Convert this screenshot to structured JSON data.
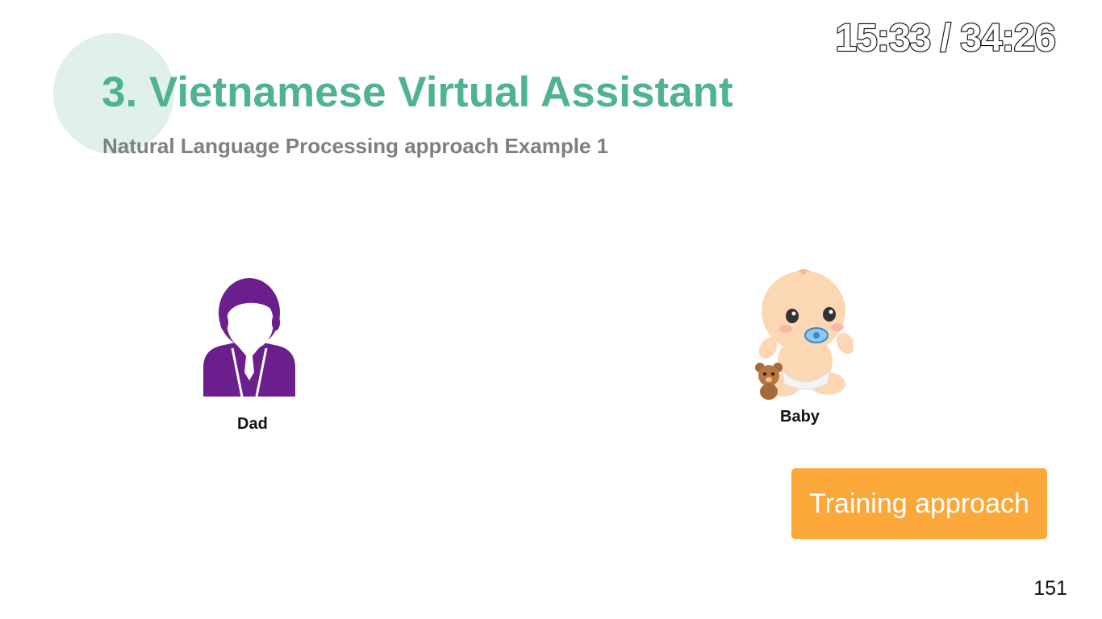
{
  "video": {
    "timestamp": "15:33 / 34:26"
  },
  "slide": {
    "title": "3. Vietnamese Virtual Assistant",
    "subtitle": "Natural Language Processing approach Example 1",
    "dad": {
      "icon": "person-icon",
      "label": "Dad"
    },
    "baby": {
      "icon": "baby-icon",
      "label": "Baby"
    },
    "button_label": "Training approach",
    "page_number": "151"
  },
  "colors": {
    "title": "#4fb48e",
    "accent_circle": "#dff1ea",
    "dad_icon": "#6a1f8c",
    "button": "#fba73a"
  }
}
